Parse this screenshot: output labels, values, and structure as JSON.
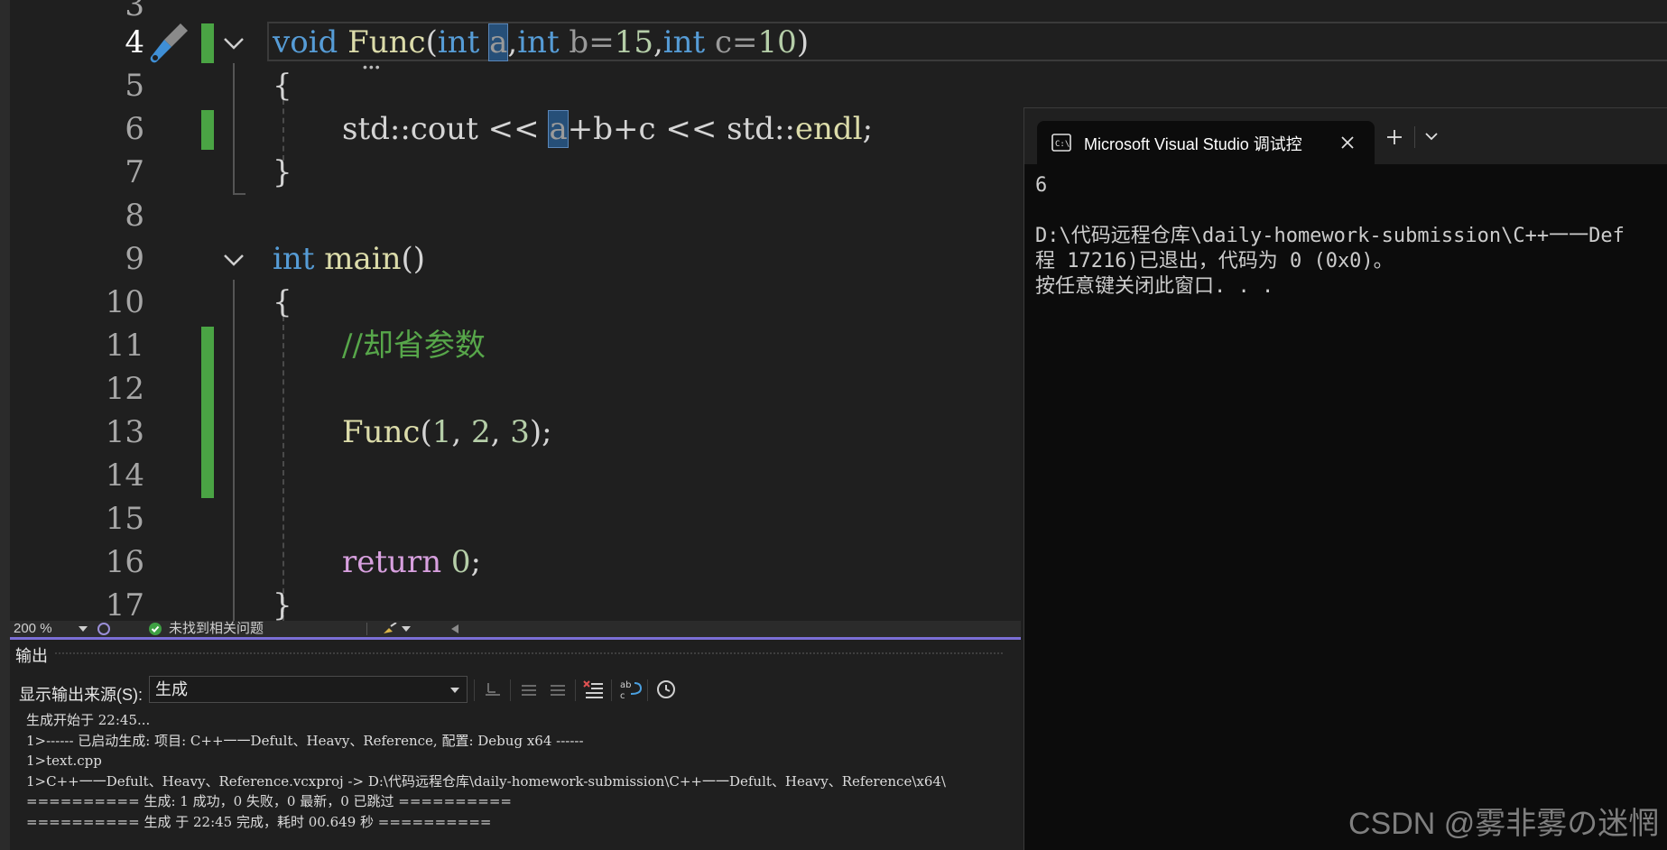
{
  "editor": {
    "line_numbers": [
      "3",
      "4",
      "5",
      "6",
      "7",
      "8",
      "9",
      "10",
      "11",
      "12",
      "13",
      "14",
      "15",
      "16",
      "17"
    ],
    "line4": {
      "kw1": "void",
      "fn": "Func",
      "p1": "(",
      "kw2": "int",
      "sp": " ",
      "a": "a",
      "c1": ",",
      "kw3": "int",
      "b": " b=",
      "n15": "15",
      "c2": ",",
      "kw4": "int",
      "c": " c=",
      "n10": "10",
      "p2": ")"
    },
    "line5": "{",
    "line6": {
      "pre": "std::cout << ",
      "a": "a",
      "post": "+b+c << std::",
      "endl": "endl",
      ";": ";"
    },
    "line7": "}",
    "line9": {
      "kw": "int",
      "fn": " main",
      "rest": "()"
    },
    "line10": "{",
    "line11": "//却省参数",
    "line13": {
      "fn": "Func",
      "open": "(",
      "n1": "1",
      "s1": ", ",
      "n2": "2",
      "s2": ", ",
      "n3": "3",
      "close": ");"
    },
    "line16": {
      "kw": "return",
      "sp": " ",
      "n": "0",
      ";": ";"
    },
    "line17": "}"
  },
  "status": {
    "zoom": "200 %",
    "issues": "未找到相关问题"
  },
  "output": {
    "title": "输出",
    "source_label": "显示输出来源(S):",
    "source_value": "生成",
    "lines": [
      "生成开始于 22:45...",
      "1>------ 已启动生成: 项目: C++一一Defult、Heavy、Reference, 配置: Debug x64 ------",
      "1>text.cpp",
      "1>C++一一Defult、Heavy、Reference.vcxproj -> D:\\代码远程仓库\\daily-homework-submission\\C++一一Defult、Heavy、Reference\\x64\\",
      "========== 生成: 1 成功，0 失败，0 最新，0 已跳过 ==========",
      "========== 生成 于 22:45 完成，耗时 00.649 秒 =========="
    ]
  },
  "console": {
    "tab_title": "Microsoft Visual Studio 调试控",
    "lines": [
      "6",
      "",
      "D:\\代码远程仓库\\daily-homework-submission\\C++一一Def",
      "程 17216)已退出，代码为 0 (0x0)。",
      "按任意键关闭此窗口. . ."
    ]
  },
  "watermark": "CSDN @雾非雾の迷惘",
  "colors": {
    "editor_bg": "#1f1f1f",
    "keyword": "#569cd6",
    "function": "#dcdcaa",
    "number": "#b5cea8",
    "comment": "#57a64a",
    "change_bar": "#4aa444",
    "console_bg": "#0c0c0c"
  }
}
